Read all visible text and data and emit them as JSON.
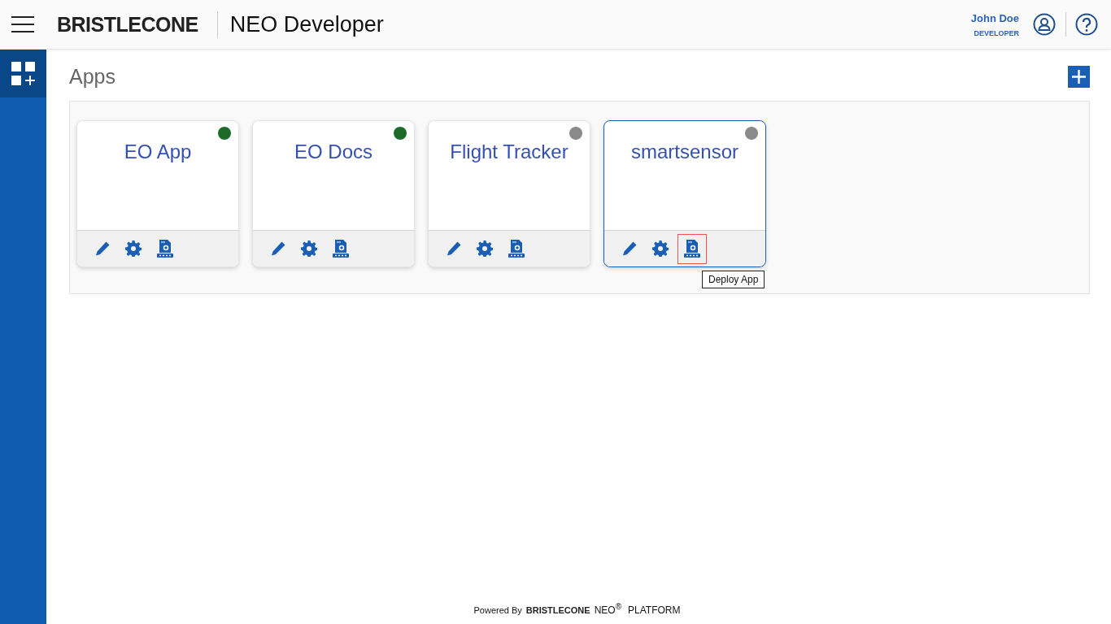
{
  "header": {
    "logo": "BRISTLECONE",
    "product": "NEO Developer",
    "user": {
      "name": "John Doe",
      "role": "DEVELOPER"
    }
  },
  "sidebar": {
    "items": [
      {
        "kind": "apps",
        "selected": true
      }
    ]
  },
  "page": {
    "title": "Apps"
  },
  "apps": [
    {
      "name": "EO App",
      "color": "#1e6b27",
      "selected": false,
      "actions": [
        {
          "kind": "edit",
          "focused": false
        },
        {
          "kind": "settings",
          "focused": false
        },
        {
          "kind": "deploy",
          "focused": false
        }
      ]
    },
    {
      "name": "EO Docs",
      "color": "#1e6b27",
      "selected": false,
      "actions": [
        {
          "kind": "edit",
          "focused": false
        },
        {
          "kind": "settings",
          "focused": false
        },
        {
          "kind": "deploy",
          "focused": false
        }
      ]
    },
    {
      "name": "Flight Tracker",
      "color": "#8a8a8a",
      "selected": false,
      "actions": [
        {
          "kind": "edit",
          "focused": false
        },
        {
          "kind": "settings",
          "focused": false
        },
        {
          "kind": "deploy",
          "focused": false
        }
      ]
    },
    {
      "name": "smartsensor",
      "color": "#8a8a8a",
      "selected": true,
      "actions": [
        {
          "kind": "edit",
          "focused": false
        },
        {
          "kind": "settings",
          "focused": false
        },
        {
          "kind": "deploy",
          "focused": true,
          "tooltip": "Deploy App"
        }
      ]
    }
  ],
  "footer": {
    "prefix": "Powered By",
    "logo": "BRISTLECONE",
    "product": "NEO",
    "mark": "®",
    "suffix": "PLATFORM"
  }
}
